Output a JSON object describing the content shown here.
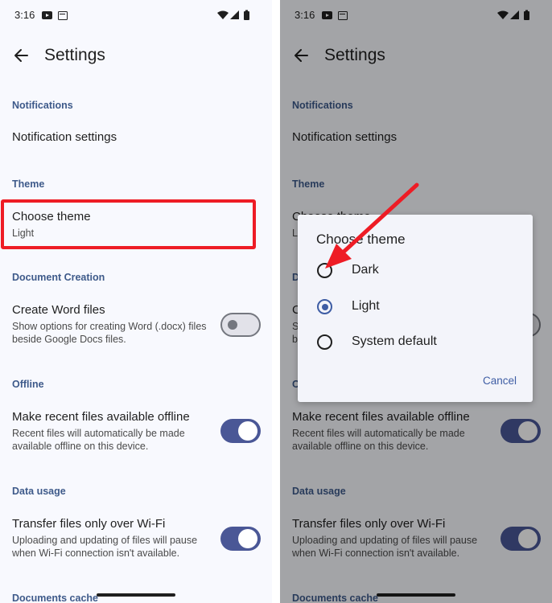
{
  "status_bar": {
    "time": "3:16"
  },
  "header": {
    "title": "Settings"
  },
  "sections": {
    "notifications": {
      "header": "Notifications",
      "item_title": "Notification settings"
    },
    "theme": {
      "header": "Theme",
      "item_title": "Choose theme",
      "item_value": "Light"
    },
    "document_creation": {
      "header": "Document Creation",
      "item_title": "Create Word files",
      "item_sub": "Show options for creating Word (.docx) files beside Google Docs files.",
      "toggle_on": false
    },
    "offline": {
      "header": "Offline",
      "item_title": "Make recent files available offline",
      "item_sub": "Recent files will automatically be made available offline on this device.",
      "toggle_on": true
    },
    "data_usage": {
      "header": "Data usage",
      "item_title": "Transfer files only over Wi-Fi",
      "item_sub": "Uploading and updating of files will pause when Wi-Fi connection isn't available.",
      "toggle_on": true
    },
    "documents_cache": {
      "header": "Documents cache"
    }
  },
  "dialog": {
    "title": "Choose theme",
    "options": [
      {
        "label": "Dark",
        "selected": false
      },
      {
        "label": "Light",
        "selected": true
      },
      {
        "label": "System default",
        "selected": false
      }
    ],
    "cancel_label": "Cancel"
  },
  "icons": {
    "back": "arrow-back-icon",
    "wifi": "wifi-icon",
    "signal": "signal-icon",
    "battery": "battery-icon",
    "youtube": "youtube-icon",
    "calendar": "calendar-icon"
  },
  "colors": {
    "accent": "#3e5da4",
    "toggle_on": "#4a5796",
    "section_header": "#3e5a8a",
    "highlight": "#ee1c25",
    "annotation_arrow": "#ee1c25"
  }
}
